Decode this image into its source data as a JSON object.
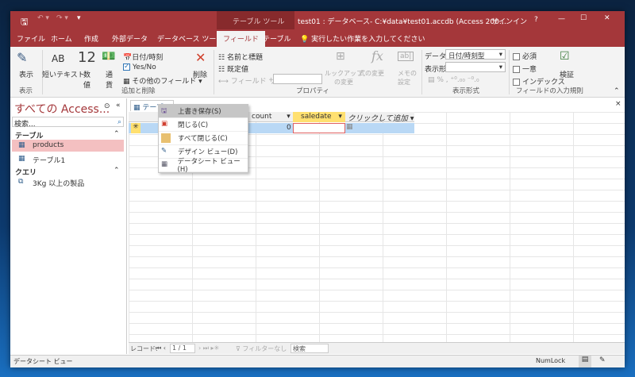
{
  "title_bar": {
    "context_tab": "テーブル ツール",
    "title": "test01 : データベース- C:¥data¥test01.accdb (Access 200…",
    "signin": "サインイン",
    "help": "?",
    "minimize": "—",
    "maximize": "☐",
    "close": "✕"
  },
  "tabs": [
    "ファイル",
    "ホーム",
    "作成",
    "外部データ",
    "データベース ツール",
    "フィールド",
    "テーブル"
  ],
  "tell_me": "実行したい作業を入力してください",
  "ribbon": {
    "view": {
      "label": "表示",
      "group": "表示"
    },
    "add_delete": {
      "short_text": "短いテキスト",
      "number": "数値",
      "currency": "通貨",
      "datetime": "日付/時刻",
      "yesno": "Yes/No",
      "other": "その他のフィールド",
      "delete": "削除",
      "group": "追加と削除",
      "ab": "AB",
      "twelve": "12"
    },
    "properties": {
      "name_caption": "名前と標題",
      "default": "既定値",
      "field_size": "フィールド サイズ",
      "lookup": "ルックアップの変更",
      "expression": "式の変更",
      "memo": "メモの設定",
      "group": "プロパティ"
    },
    "format": {
      "data_type_label": "データ型:",
      "data_type_value": "日付/時刻型",
      "format_label": "表示形式:",
      "format_value": "",
      "group": "表示形式"
    },
    "validation": {
      "required": "必須",
      "unique": "一意",
      "indexed": "インデックス",
      "validate": "検証",
      "group": "フィールドの入力規則"
    }
  },
  "nav": {
    "title": "すべての Access...",
    "search_placeholder": "検索...",
    "sections": [
      {
        "label": "テーブル",
        "items": [
          "products",
          "テーブル1"
        ]
      },
      {
        "label": "クエリ",
        "items": [
          "3Kg 以上の製品"
        ]
      }
    ]
  },
  "doc_tab": "テーブル1",
  "columns": [
    "count",
    "saledate",
    "クリックして追加"
  ],
  "new_row": {
    "count": "0"
  },
  "context_menu": [
    "上書き保存(S)",
    "閉じる(C)",
    "すべて閉じる(C)",
    "デザイン ビュー(D)",
    "データシート ビュー(H)"
  ],
  "record_bar": {
    "label": "レコード:",
    "position": "1 / 1",
    "filter": "フィルターなし",
    "search": "検索"
  },
  "status": {
    "left": "データシート ビュー",
    "numlock": "NumLock"
  }
}
